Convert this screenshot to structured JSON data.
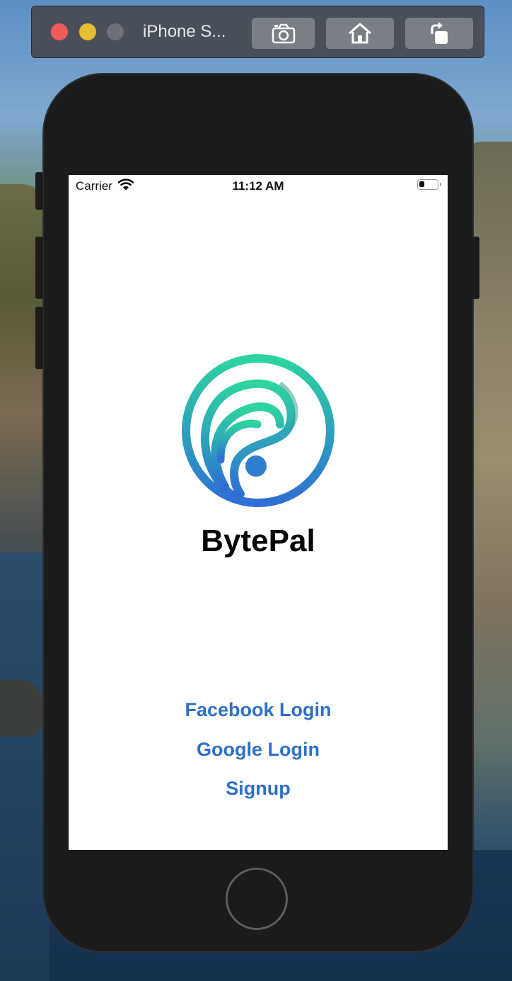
{
  "simulator": {
    "window_title": "iPhone S...",
    "buttons": [
      {
        "name": "screenshot",
        "icon": "camera-icon"
      },
      {
        "name": "home",
        "icon": "home-icon"
      },
      {
        "name": "rotate",
        "icon": "rotate-icon"
      }
    ]
  },
  "status_bar": {
    "carrier": "Carrier",
    "time": "11:12 AM",
    "battery_level": 0.3
  },
  "app": {
    "name": "BytePal",
    "logo_icon": "bytepal-logo",
    "colors": {
      "gradient_top": "#2dd4a0",
      "gradient_bottom": "#2f6fd6",
      "link": "#2f6fc6"
    }
  },
  "login": {
    "facebook_label": "Facebook Login",
    "google_label": "Google Login",
    "signup_label": "Signup"
  }
}
